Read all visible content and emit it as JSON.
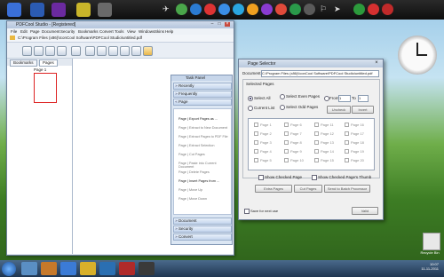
{
  "main_window": {
    "title": "PDFCool Studio - [Registered]",
    "menu": [
      "File",
      "Edit",
      "Page",
      "Document",
      "Security",
      "Bookmarks",
      "Convert",
      "Tools",
      "View",
      "Windows",
      "Skins",
      "Help"
    ],
    "path": "C:\\Program Files (x86)\\IconCool Software\\PDFCool Studio\\untitled.pdf",
    "tabs": [
      "Bookmarks",
      "Pages"
    ],
    "thumb_label": "Page 1"
  },
  "task_panel": {
    "title": "Task Panel",
    "sections_top": [
      "Recently",
      "Frequently",
      "Page"
    ],
    "page_items": [
      "Page | Export Pages as ...",
      "Page | Extract to New Document",
      "Page | Extract Pages to PDF File",
      "Page | Extract Selection",
      "Page | Cut Pages",
      "Page | Paste into Current Document",
      "Page | Delete Pages",
      "Page | Insert Pages from ...",
      "Page | Move Up",
      "Page | Move Down"
    ],
    "sections_bottom": [
      "Document",
      "Security",
      "Convert"
    ]
  },
  "dialog": {
    "title": "Page Selector",
    "document_label": "Document",
    "document_path": "C:\\Program Files (x86)\\IconCool Software\\PDFCool Studio\\untitled.pdf",
    "selected_pages_label": "Selected Pages",
    "options": {
      "select_all": "Select All",
      "current_list": "Current List",
      "select_even": "Select Even Pages",
      "select_odd": "Select Odd Pages",
      "from": "From",
      "from_value": "1",
      "to": "To",
      "to_value": "1",
      "uncheck": "Uncheck",
      "invert": "Invert"
    },
    "pages": [
      "Page 1",
      "Page 2",
      "Page 3",
      "Page 4",
      "Page 5",
      "Page 6",
      "Page 7",
      "Page 8",
      "Page 9",
      "Page 10",
      "Page 11",
      "Page 12",
      "Page 13",
      "Page 14",
      "Page 15",
      "Page 16",
      "Page 17",
      "Page 18",
      "Page 19",
      "Page 20"
    ],
    "show_checked": "Show Checked Page",
    "show_checked_thumb": "Show Checked Page's Thumb",
    "actions": [
      "Extra Pages",
      "Cut Pages",
      "Send to Batch Processor"
    ],
    "save_for_next": "Save for next use",
    "ok": "Valid"
  },
  "taskbar": {
    "time": "10:07",
    "date": "11-11-2011"
  },
  "desktop": {
    "icon_label": "Recycle Bin"
  }
}
